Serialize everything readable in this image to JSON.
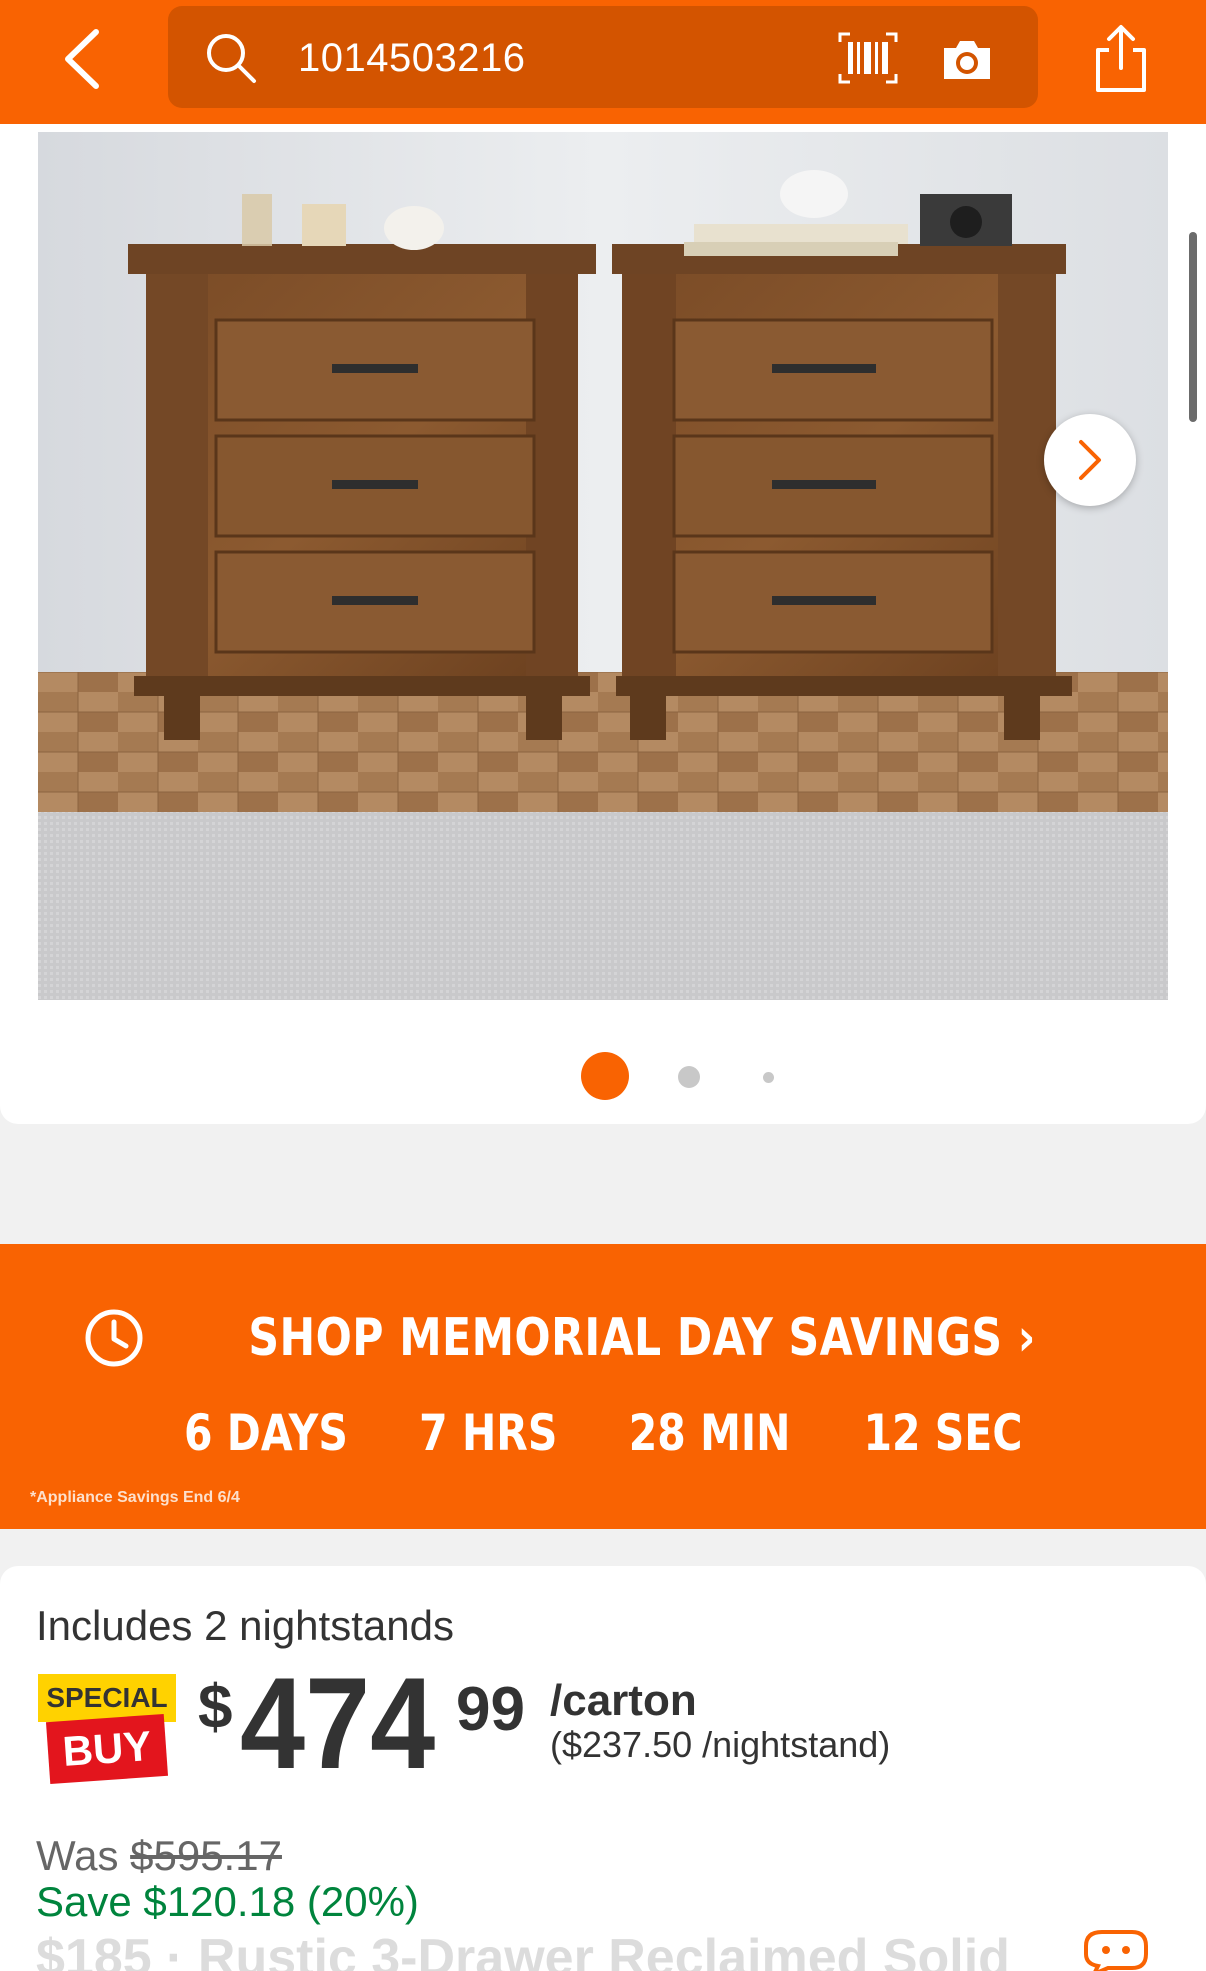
{
  "header": {
    "search_value": "1014503216",
    "icons": [
      "back-arrow-icon",
      "search-icon",
      "barcode-scan-icon",
      "camera-icon",
      "share-icon"
    ],
    "accent_color": "#f96302",
    "search_bg_color": "#d35400"
  },
  "gallery": {
    "image_count": 3,
    "active_index": 0,
    "next_icon": "chevron-right-icon"
  },
  "promo": {
    "title": "SHOP MEMORIAL DAY SAVINGS",
    "chevron": "›",
    "countdown": {
      "days": "6 DAYS",
      "hours": "7 HRS",
      "minutes": "28 MIN",
      "seconds": "12 SEC"
    },
    "note": "*Appliance Savings End 6/4"
  },
  "product": {
    "includes": "Includes 2 nightstands",
    "badge_top": "SPECIAL",
    "badge_bottom": "BUY",
    "currency": "$",
    "price_dollars": "474",
    "price_cents": "99",
    "unit": "/carton",
    "per_item": "($237.50 /nightstand)",
    "was_label": "Was",
    "was_price": "$595.17",
    "save_text": "Save $120.18 (20%)",
    "title_partial": "$185 · Rustic 3-Drawer Reclaimed Solid"
  }
}
